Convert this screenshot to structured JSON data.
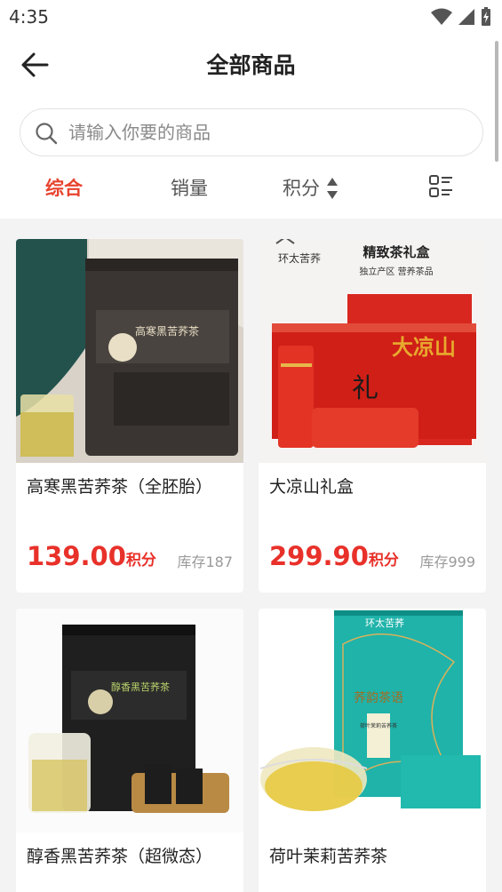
{
  "status_bar": {
    "time": "4:35"
  },
  "header": {
    "title": "全部商品"
  },
  "search": {
    "placeholder": "请输入你要的商品"
  },
  "sort_tabs": [
    {
      "label": "综合",
      "active": true
    },
    {
      "label": "销量",
      "active": false
    },
    {
      "label": "积分",
      "active": false
    }
  ],
  "products": [
    {
      "name": "高寒黑苦荞茶（全胚胎）",
      "price": "139.00",
      "unit": "积分",
      "stock": "库存187",
      "image": "black-package-tea"
    },
    {
      "name": "大凉山礼盒",
      "price": "299.90",
      "unit": "积分",
      "stock": "库存999",
      "image": "red-gift-box"
    },
    {
      "name": "醇香黑苦荞茶（超微态）",
      "image": "black-package-tea-cup"
    },
    {
      "name": "荷叶茉莉苦荞茶",
      "image": "teal-box-tea"
    }
  ],
  "image_text": {
    "brand": "环太苦荞",
    "gift_heading": "精致茶礼盒",
    "gift_sub": "独立产区  营养茶品",
    "pkg1_title": "高寒黑苦荞茶",
    "pkg3_title": "醇香黑苦荞茶",
    "box4_title": "荞韵茶语",
    "box4_sub": "荷叶茉莉苦荞茶",
    "gift_seal": "大凉山",
    "gift_li": "礼"
  },
  "colors": {
    "accent": "#e8432e",
    "price": "#e8312a"
  }
}
